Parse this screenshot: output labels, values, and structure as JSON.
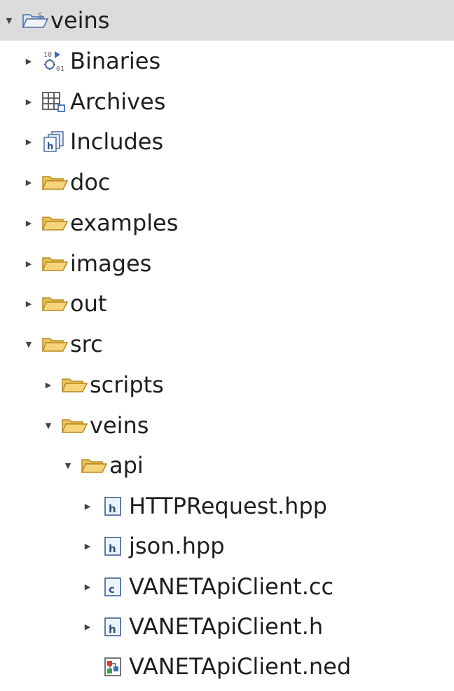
{
  "tree": [
    {
      "label": "veins",
      "icon": "project-folder-icon",
      "expanded": true,
      "depth": 0,
      "selected": true
    },
    {
      "label": "Binaries",
      "icon": "binaries-icon",
      "expanded": false,
      "depth": 1
    },
    {
      "label": "Archives",
      "icon": "archives-icon",
      "expanded": false,
      "depth": 1
    },
    {
      "label": "Includes",
      "icon": "includes-icon",
      "expanded": false,
      "depth": 1
    },
    {
      "label": "doc",
      "icon": "folder-icon",
      "expanded": false,
      "depth": 1
    },
    {
      "label": "examples",
      "icon": "folder-icon",
      "expanded": false,
      "depth": 1
    },
    {
      "label": "images",
      "icon": "folder-icon",
      "expanded": false,
      "depth": 1
    },
    {
      "label": "out",
      "icon": "folder-icon",
      "expanded": false,
      "depth": 1
    },
    {
      "label": "src",
      "icon": "folder-icon",
      "expanded": true,
      "depth": 1
    },
    {
      "label": "scripts",
      "icon": "folder-icon",
      "expanded": false,
      "depth": 2
    },
    {
      "label": "veins",
      "icon": "folder-icon",
      "expanded": true,
      "depth": 2
    },
    {
      "label": "api",
      "icon": "folder-icon",
      "expanded": true,
      "depth": 3
    },
    {
      "label": "HTTPRequest.hpp",
      "icon": "header-file-icon",
      "expanded": false,
      "depth": 4
    },
    {
      "label": "json.hpp",
      "icon": "header-file-icon",
      "expanded": false,
      "depth": 4
    },
    {
      "label": "VANETApiClient.cc",
      "icon": "source-file-icon",
      "expanded": false,
      "depth": 4
    },
    {
      "label": "VANETApiClient.h",
      "icon": "header-file-icon",
      "expanded": false,
      "depth": 4
    },
    {
      "label": "VANETApiClient.ned",
      "icon": "ned-file-icon",
      "expanded": null,
      "depth": 4
    }
  ],
  "colors": {
    "selection": "#dcdcdc",
    "folder_fill": "#f6d57a",
    "folder_stroke": "#b98a1c",
    "file_stroke": "#4a6fa0"
  }
}
